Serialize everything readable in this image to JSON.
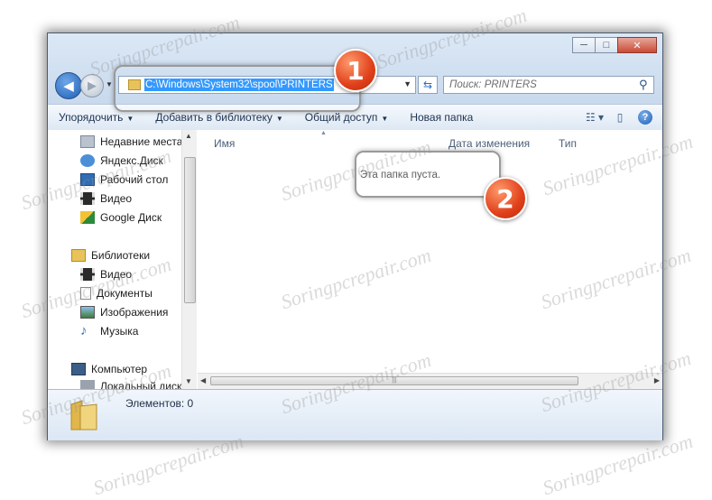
{
  "watermark": "Soringpcrepair.com",
  "window": {
    "controls": {
      "minimize": "─",
      "maximize": "□",
      "close": "✕"
    }
  },
  "nav": {
    "back_icon": "◀",
    "forward_icon": "▶",
    "address": "C:\\Windows\\System32\\spool\\PRINTERS",
    "search_placeholder": "Поиск: PRINTERS"
  },
  "toolbar": {
    "organize": "Упорядочить",
    "add_to_library": "Добавить в библиотеку",
    "share": "Общий доступ",
    "new_folder": "Новая папка"
  },
  "sidebar": {
    "favorites": [
      {
        "label": "Недавние места",
        "icon": "recent-places-icon"
      },
      {
        "label": "Яндекс.Диск",
        "icon": "yandex-disk-icon"
      },
      {
        "label": "Рабочий стол",
        "icon": "desktop-icon"
      },
      {
        "label": "Видео",
        "icon": "video-icon"
      },
      {
        "label": "Google Диск",
        "icon": "google-drive-icon"
      }
    ],
    "libraries_label": "Библиотеки",
    "libraries": [
      {
        "label": "Видео",
        "icon": "video-icon"
      },
      {
        "label": "Документы",
        "icon": "documents-icon"
      },
      {
        "label": "Изображения",
        "icon": "images-icon"
      },
      {
        "label": "Музыка",
        "icon": "music-icon"
      }
    ],
    "computer_label": "Компьютер",
    "local_disk_label": "Локальный диск"
  },
  "columns": {
    "name": "Имя",
    "date": "Дата изменения",
    "type": "Тип"
  },
  "empty_message": "Эта папка пуста.",
  "status": {
    "items_count": "Элементов: 0"
  },
  "callouts": [
    {
      "number": "1"
    },
    {
      "number": "2"
    }
  ],
  "colors": {
    "accent": "#3399ff",
    "badge": "#e0401a"
  }
}
